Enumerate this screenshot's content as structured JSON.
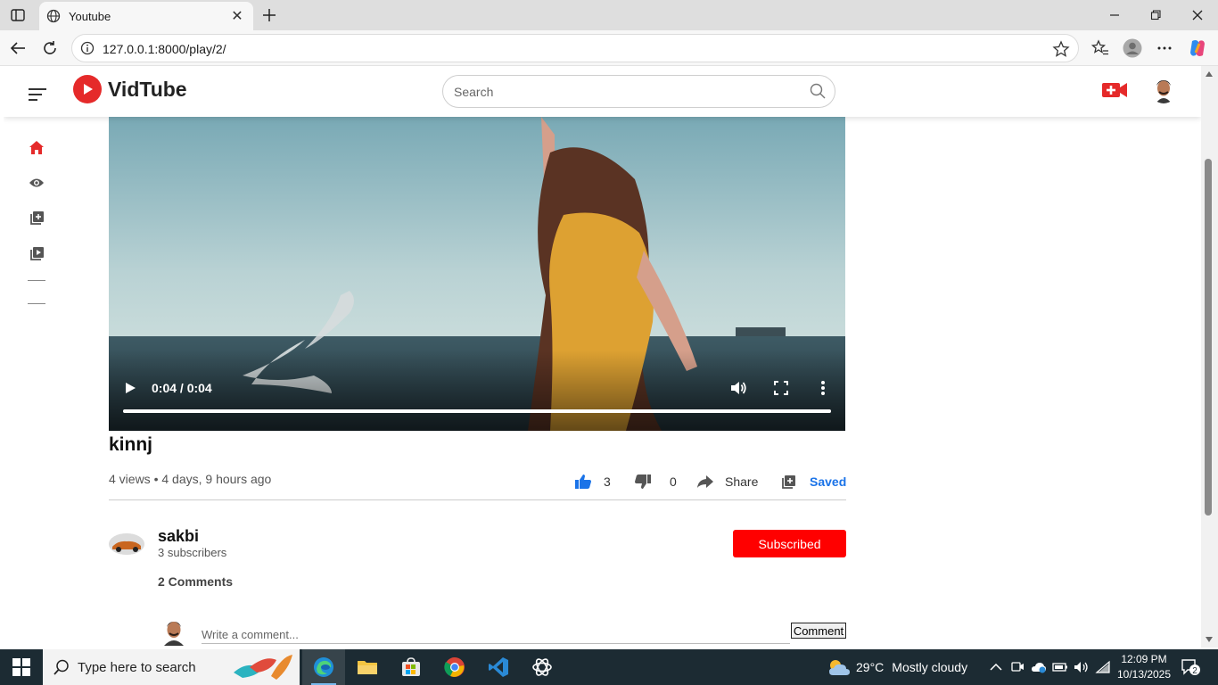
{
  "browser": {
    "tab_title": "Youtube",
    "url": "127.0.0.1:8000/play/2/"
  },
  "site": {
    "logo_text": "VidTube",
    "search_placeholder": "Search",
    "brand_color": "#e52a2a"
  },
  "sidebar": {
    "items": [
      {
        "icon": "home-icon",
        "active": true
      },
      {
        "icon": "eye-icon",
        "active": false
      },
      {
        "icon": "playlist-add-icon",
        "active": false
      },
      {
        "icon": "video-library-icon",
        "active": false
      }
    ]
  },
  "video": {
    "time": "0:04 / 0:04",
    "progress": 1.0,
    "title": "kinnj",
    "meta": "4 views • 4 days, 9 hours ago",
    "likes": "3",
    "dislikes": "0",
    "share_label": "Share",
    "saved_label": "Saved"
  },
  "channel": {
    "name": "sakbi",
    "subscribers": "3 subscribers",
    "subscribe_label": "Subscribed"
  },
  "comments": {
    "count_label": "2 Comments",
    "input_placeholder": "Write a comment...",
    "button_label": "Comment"
  },
  "taskbar": {
    "search_text": "Type here to search",
    "temperature": "29°C",
    "weather": "Mostly cloudy",
    "time": "12:09 PM",
    "date": "10/13/2025",
    "notifications": "2"
  }
}
